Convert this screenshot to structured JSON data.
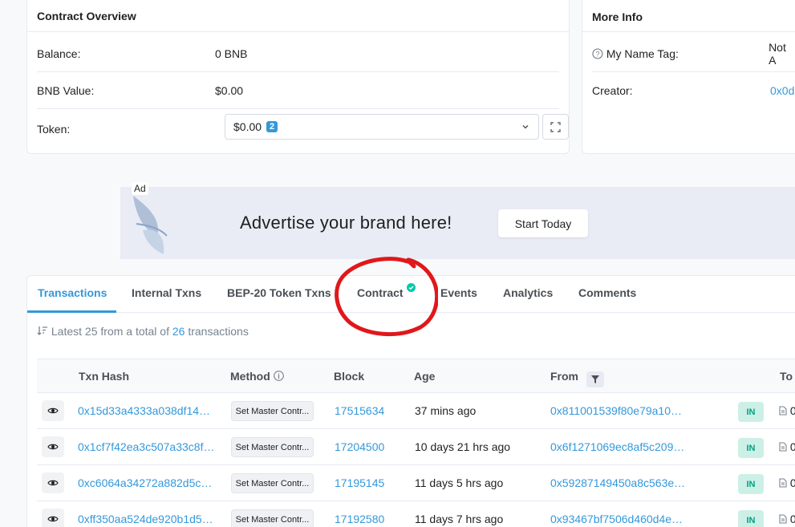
{
  "overview": {
    "title": "Contract Overview",
    "balance_label": "Balance:",
    "balance_value": "0 BNB",
    "bnb_value_label": "BNB Value:",
    "bnb_value": "$0.00",
    "token_label": "Token:",
    "token_value": "$0.00",
    "token_count": "2"
  },
  "more_info": {
    "title": "More Info",
    "name_tag_label": "My Name Tag:",
    "name_tag_value": "Not A",
    "creator_label": "Creator:",
    "creator_value": "0x0d"
  },
  "ad": {
    "tag": "Ad",
    "text": "Advertise your brand here!",
    "button": "Start Today"
  },
  "tabs": [
    "Transactions",
    "Internal Txns",
    "BEP-20 Token Txns",
    "Contract",
    "Events",
    "Analytics",
    "Comments"
  ],
  "summary": {
    "prefix": "Latest 25 from a total of",
    "count": "26",
    "suffix": "transactions"
  },
  "table": {
    "headers": {
      "txn_hash": "Txn Hash",
      "method": "Method",
      "block": "Block",
      "age": "Age",
      "from": "From",
      "to": "To"
    },
    "rows": [
      {
        "hash": "0x15d33a4333a038df14…",
        "method": "Set Master Contr...",
        "block": "17515634",
        "age": "37 mins ago",
        "from": "0x811001539f80e79a10…",
        "dir": "IN",
        "to": "0"
      },
      {
        "hash": "0x1cf7f42ea3c507a33c8f…",
        "method": "Set Master Contr...",
        "block": "17204500",
        "age": "10 days 21 hrs ago",
        "from": "0x6f1271069ec8af5c209…",
        "dir": "IN",
        "to": "0"
      },
      {
        "hash": "0xc6064a34272a882d5c…",
        "method": "Set Master Contr...",
        "block": "17195145",
        "age": "11 days 5 hrs ago",
        "from": "0x59287149450a8c563e…",
        "dir": "IN",
        "to": "0"
      },
      {
        "hash": "0xff350aa524de920b1d5…",
        "method": "Set Master Contr...",
        "block": "17192580",
        "age": "11 days 7 hrs ago",
        "from": "0x93467bf7506d460d4e…",
        "dir": "IN",
        "to": "0"
      }
    ]
  },
  "colors": {
    "accent": "#3498db",
    "annotation": "#e0181b",
    "in_badge_bg": "#cdf0e6",
    "in_badge_text": "#00a186"
  }
}
